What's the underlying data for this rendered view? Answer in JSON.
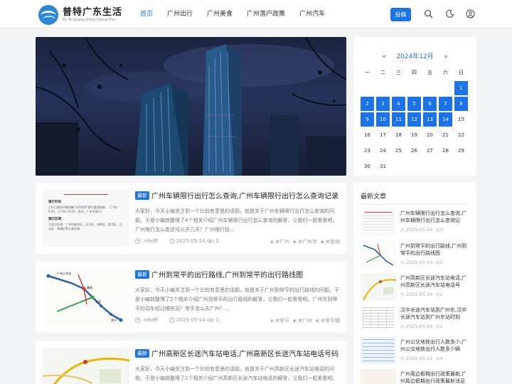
{
  "site": {
    "name": "普特广东生活",
    "subtitle": "Pu Te Guang Dong Sheng Huo"
  },
  "nav": [
    {
      "label": "首页",
      "active": true
    },
    {
      "label": "广州出行",
      "active": false
    },
    {
      "label": "广州美食",
      "active": false
    },
    {
      "label": "广州落户政策",
      "active": false
    },
    {
      "label": "广州汽车",
      "active": false
    }
  ],
  "header": {
    "post_label": "投稿",
    "icons": [
      "search-icon",
      "moon-icon",
      "user-icon"
    ]
  },
  "posts": [
    {
      "badge": "最新",
      "title": "广州车辆限行出行怎么查询,广州车辆限行出行怎么查询记录",
      "excerpt": "大家好，今天小编关注到一个比较有意思的话题，就是关于广州车辆限行出行怎么查询的问题，于是小编就整理了4个相关介绍广州车辆限行出行怎么查询的解答，让我们一起看看吧。广州限行怎么查还可以开几天？广州限行拍...",
      "author": "nihdff",
      "date": "2025-05-14",
      "views": "3",
      "tags": [
        "#广州",
        "#广州市",
        "#查询"
      ]
    },
    {
      "badge": "最新",
      "title": "广州到常平的出行路线,广州到常平的出行路线图",
      "excerpt": "大家好，今天小编关注到一个比较有意思的话题，就是关于广州到常平的出行路线的问题，于是小编就整理了2个相关介绍广州到常平的出行路线的解答，让我们一起看看吧。广州东到常平的动车经过哪些站？常平怎么去广州？...",
      "author": "nihdff",
      "date": "2025-05-14",
      "views": "1",
      "tags": [
        "#常平",
        "#广州",
        "#常平镇"
      ]
    },
    {
      "badge": "最新",
      "title": "广州高新区长途汽车站电话,广州高新区长途汽车站电话号码",
      "excerpt": "大家好，今天小编关注到一个比较有意思的话题，就是关于广州高新区长途汽车站电话的问题，于是小编就整理了2个相关介绍广州高新区长途汽车站电话的解答，让我们一起看看吧。"
    }
  ],
  "thumb1": {
    "text1": "限行时间",
    "text2": "工作日期间早晚高峰\"开四停四\"限行管理措施：（7:00-9:00，17:00-19:00）限号，广州不限行）",
    "text3": "限行区域",
    "text4": "大部分区域：广州市越秀区、天河区、海珠区、荔湾区、白云区、黄埔区等主要区域"
  },
  "thumb2": {
    "labels": [
      "广州火车站",
      "番禺",
      "东莞",
      "常平"
    ]
  },
  "calendar": {
    "prev": "«",
    "month_label": "2024年12月",
    "next": "»",
    "weekdays": [
      "一",
      "二",
      "三",
      "四",
      "五",
      "六",
      "日"
    ],
    "cells": [
      "",
      "",
      "",
      "",
      "",
      "",
      "1",
      "2",
      "3",
      "4",
      "5",
      "6",
      "7",
      "8",
      "9",
      "10",
      "11",
      "12",
      "13",
      "14",
      "15",
      "16",
      "17",
      "18",
      "19",
      "20",
      "21",
      "22",
      "23",
      "24",
      "25",
      "26",
      "27",
      "28",
      "29",
      "30",
      "31"
    ],
    "linked_through": 14
  },
  "recent": {
    "title": "最新文章",
    "items": [
      {
        "title": "广州车辆限行出行怎么查询,广州车辆限行出行怎么查询记",
        "date": "2025-05-14",
        "views": "3"
      },
      {
        "title": "广州到常平的出行路线,广州到常平的出行路线图",
        "date": "2025-05-14",
        "views": "1"
      },
      {
        "title": "广州高新区长途汽车站电话,广州高新区长途汽车站电话号",
        "date": "2025-05-14",
        "views": "2"
      },
      {
        "title": "汉中长途汽车站到广州东,汉中长途汽车站到广州东站时刻",
        "date": "2025-05-14",
        "views": "2"
      },
      {
        "title": "广州公交地铁出行人数多少,广州公交地铁出行人数多少辆",
        "date": "2025-05-13",
        "views": "4"
      },
      {
        "title": "广州周边假期出行政策最新,广州周边假期出行政策最新消息"
      }
    ]
  },
  "colors": {
    "accent": "#1a73e8",
    "page_bg": "#f2f3f5",
    "banner_sky": "#1b2440"
  }
}
